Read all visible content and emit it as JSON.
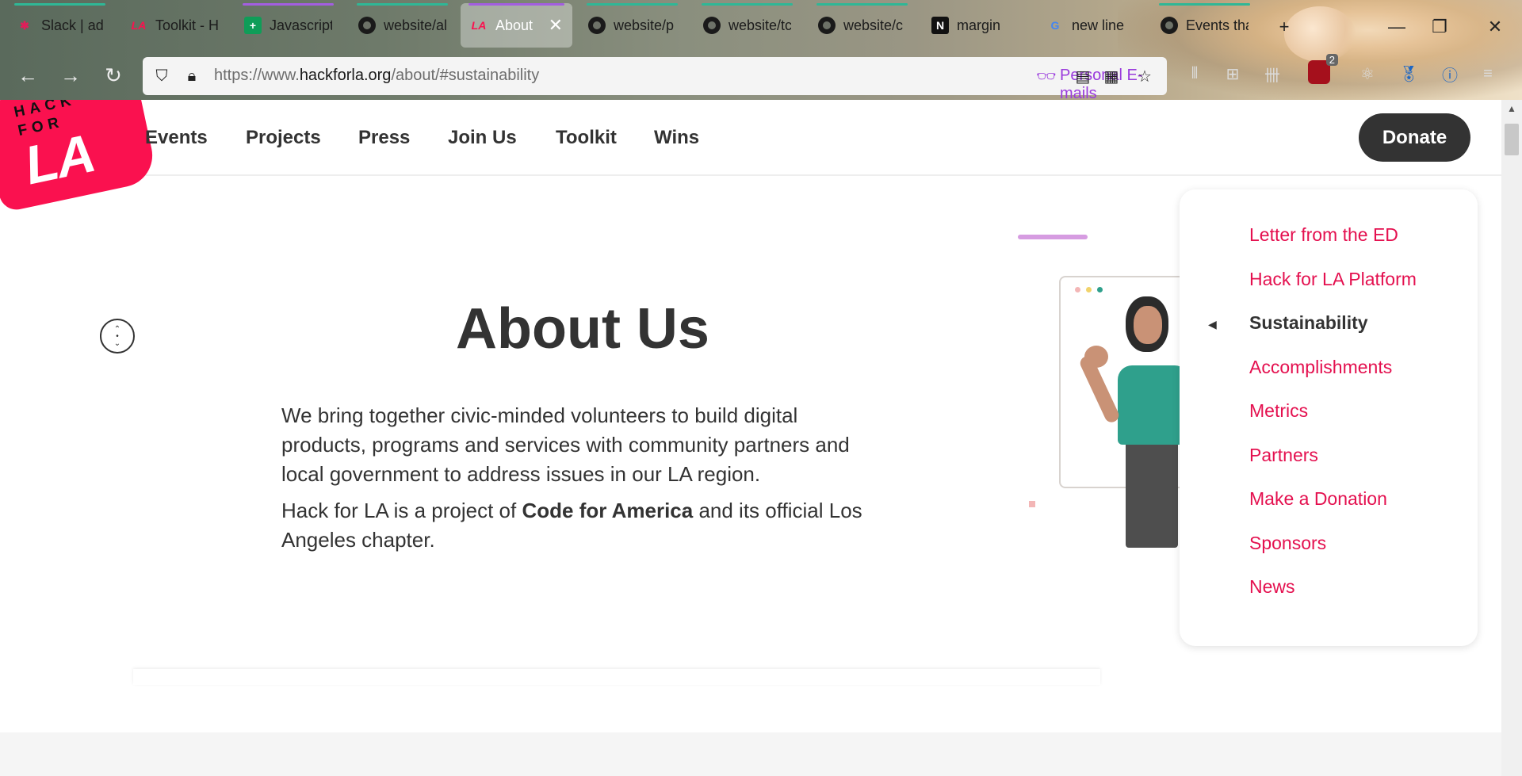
{
  "browser": {
    "tabs": [
      {
        "title": "Slack | adi",
        "favicon": "slack-icon",
        "indicator": "#2fb796"
      },
      {
        "title": "Toolkit - H",
        "favicon": "hackforla-icon",
        "indicator": ""
      },
      {
        "title": "Javascript",
        "favicon": "sheets-icon",
        "indicator": "#a35ee0"
      },
      {
        "title": "website/al",
        "favicon": "github-icon",
        "indicator": "#2fb796"
      },
      {
        "title": "About",
        "favicon": "hackforla-icon",
        "indicator": "#a35ee0",
        "active": true
      },
      {
        "title": "website/p",
        "favicon": "github-icon",
        "indicator": "#2fb796"
      },
      {
        "title": "website/tc",
        "favicon": "github-icon",
        "indicator": "#2fb796"
      },
      {
        "title": "website/c",
        "favicon": "github-icon",
        "indicator": "#2fb796"
      },
      {
        "title": "margin",
        "favicon": "notion-icon",
        "indicator": ""
      },
      {
        "title": "new line",
        "favicon": "google-icon",
        "indicator": ""
      },
      {
        "title": "Events tha",
        "favicon": "github-icon",
        "indicator": "#2fb796"
      }
    ],
    "url_prefix": "https://www.",
    "url_domain": "hackforla.org",
    "url_path": "/about/#sustainability",
    "personal_label": "Personal E-mails",
    "extension_badge": "2"
  },
  "site": {
    "logo_line1": "HACK",
    "logo_line2": "FOR",
    "logo_big": "LA",
    "nav": [
      "Events",
      "Projects",
      "Press",
      "Join Us",
      "Toolkit",
      "Wins"
    ],
    "donate_label": "Donate"
  },
  "main": {
    "title": "About Us",
    "para1": "We bring together civic-minded volunteers to build digital products, programs and services with community partners and local government to address issues in our LA region.",
    "para2_pre": "Hack for LA is a project of ",
    "para2_bold": "Code for America",
    "para2_post": " and its official Los Angeles chapter."
  },
  "sidebar": {
    "items": [
      {
        "label": "Letter from the ED",
        "active": false
      },
      {
        "label": "Hack for LA Platform",
        "active": false
      },
      {
        "label": "Sustainability",
        "active": true
      },
      {
        "label": "Accomplishments",
        "active": false
      },
      {
        "label": "Metrics",
        "active": false
      },
      {
        "label": "Partners",
        "active": false
      },
      {
        "label": "Make a Donation",
        "active": false
      },
      {
        "label": "Sponsors",
        "active": false
      },
      {
        "label": "News",
        "active": false
      }
    ]
  },
  "colors": {
    "brand_pink": "#fa114f",
    "link_pink": "#e4104f",
    "dark_text": "#333333",
    "personal_purple": "#9a3bdc"
  }
}
